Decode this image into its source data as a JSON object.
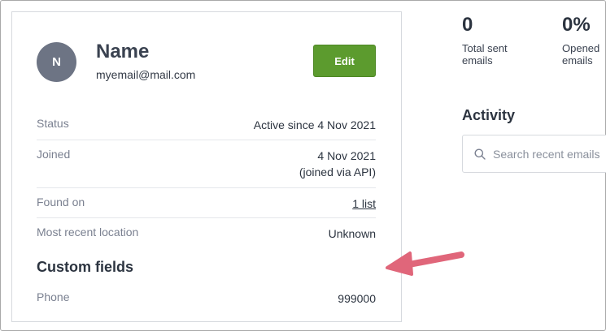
{
  "contact": {
    "avatar_initial": "N",
    "name": "Name",
    "email": "myemail@mail.com",
    "edit_label": "Edit"
  },
  "details": [
    {
      "label": "Status",
      "value": "Active since 4 Nov 2021"
    },
    {
      "label": "Joined",
      "value": "4 Nov 2021",
      "value_sub": "(joined via API)"
    },
    {
      "label": "Found on",
      "value": "1 list"
    },
    {
      "label": "Most recent location",
      "value": "Unknown"
    }
  ],
  "custom_fields": {
    "title": "Custom fields",
    "items": [
      {
        "label": "Phone",
        "value": "999000"
      }
    ]
  },
  "stats": [
    {
      "value": "0",
      "label_line1": "Total sent",
      "label_line2": "emails"
    },
    {
      "value": "0%",
      "label_line1": "Opened",
      "label_line2": "emails"
    }
  ],
  "activity": {
    "title": "Activity",
    "search_placeholder": "Search recent emails"
  },
  "colors": {
    "edit_button": "#5c9b2e",
    "link": "#2d7dd2",
    "annotation_arrow": "#e0667a",
    "avatar": "#6d7484"
  }
}
